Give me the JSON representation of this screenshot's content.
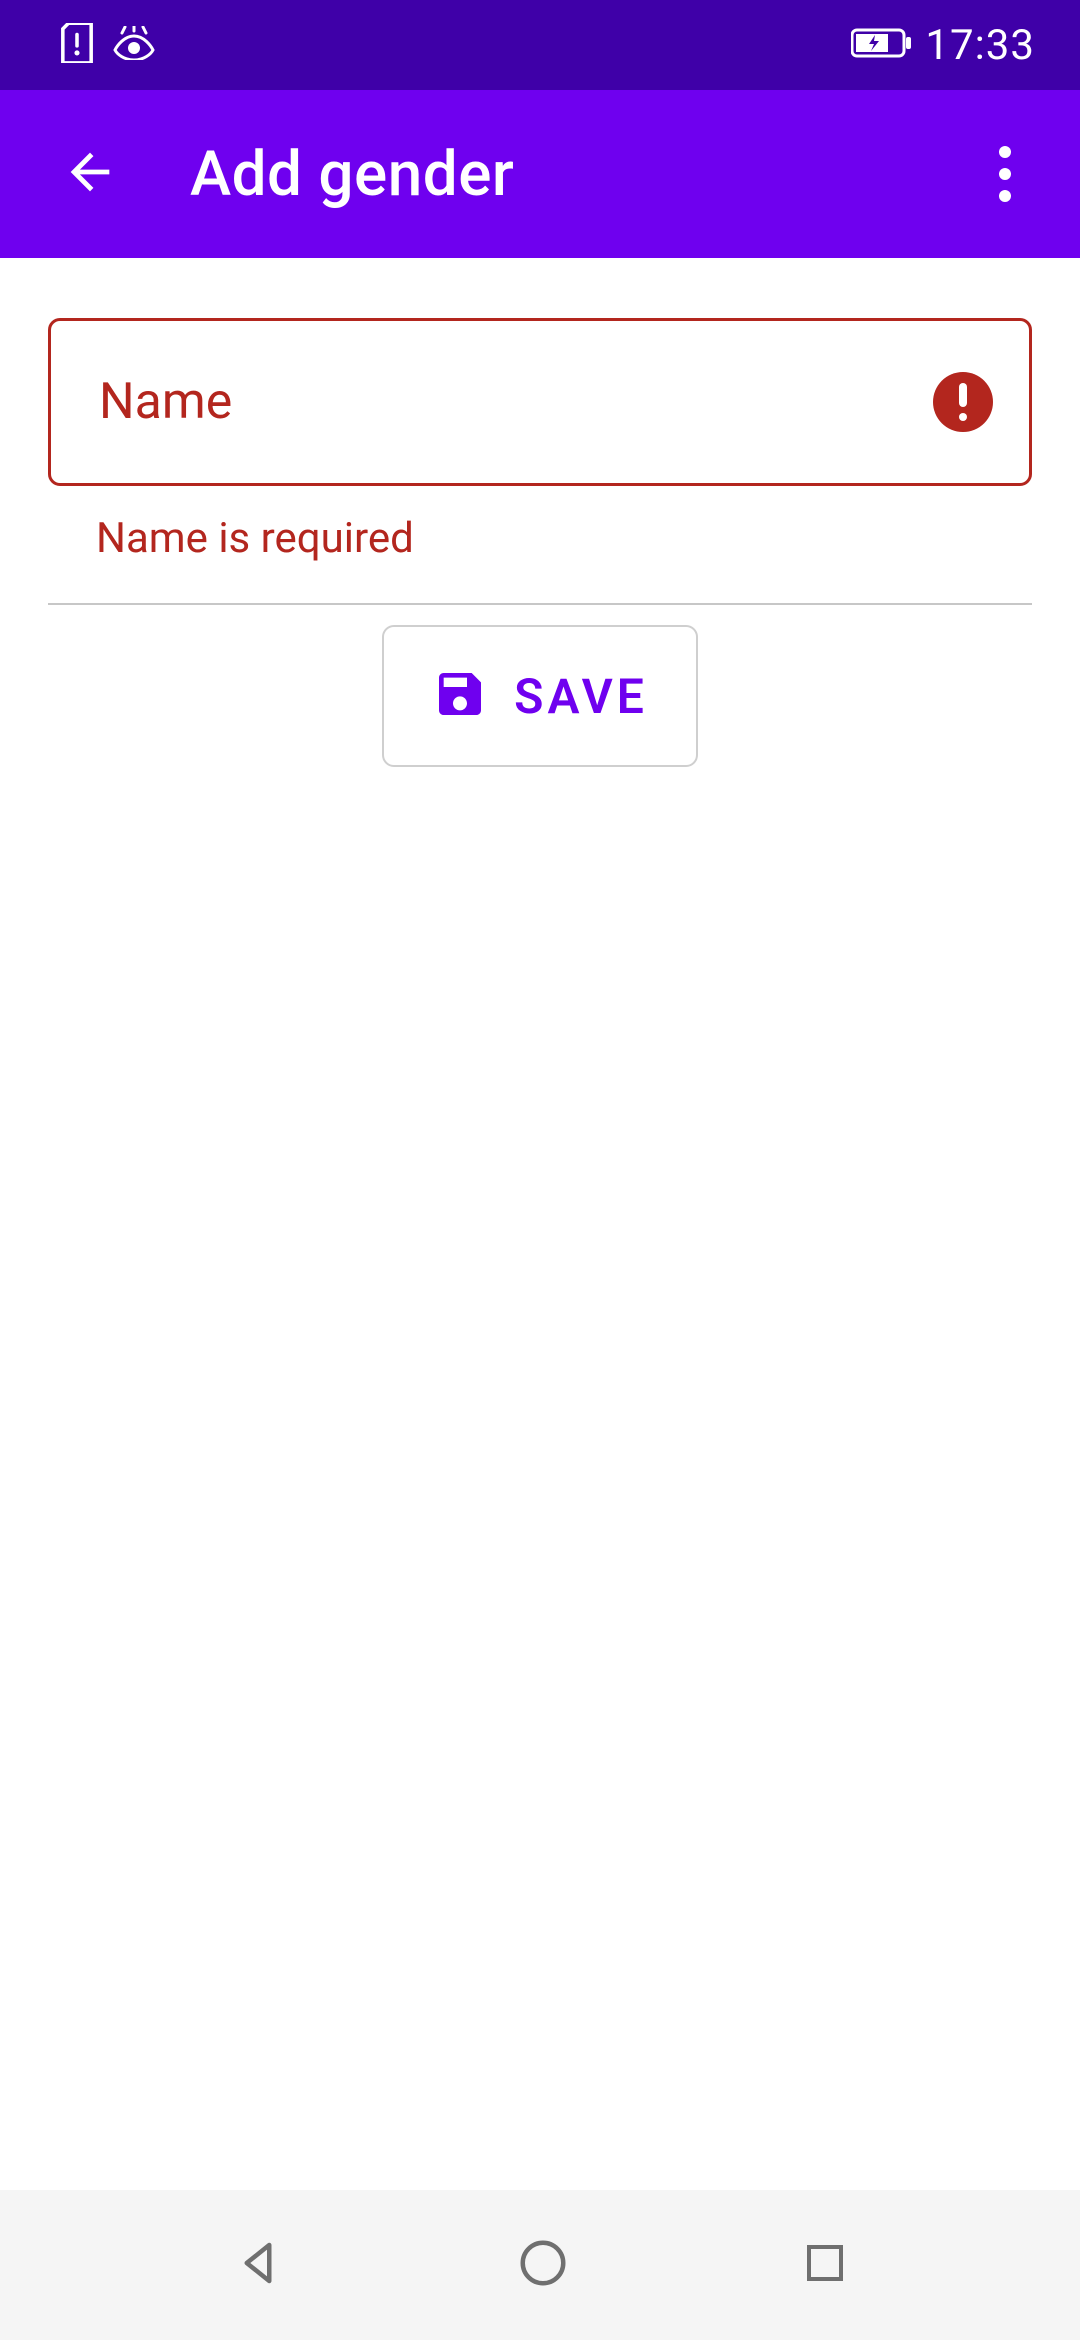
{
  "status": {
    "time": "17:33"
  },
  "appbar": {
    "title": "Add gender"
  },
  "form": {
    "name_label": "Name",
    "name_error": "Name is required"
  },
  "actions": {
    "save_label": "SAVE"
  },
  "colors": {
    "primary": "#6f00ef",
    "status_bg": "#3f00a8",
    "error": "#b3261e"
  }
}
